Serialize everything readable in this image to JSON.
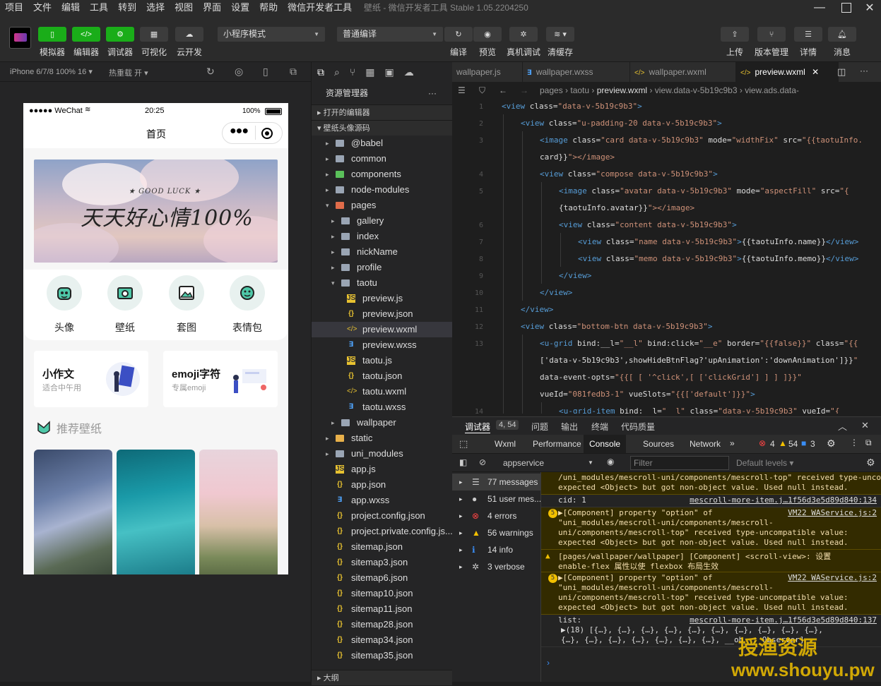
{
  "menu": [
    "项目",
    "文件",
    "编辑",
    "工具",
    "转到",
    "选择",
    "视图",
    "界面",
    "设置",
    "帮助",
    "微信开发者工具"
  ],
  "window_title": "壁纸 - 微信开发者工具 Stable 1.05.2204250",
  "toolbar": {
    "simulator": "模拟器",
    "editor": "编辑器",
    "debugger": "调试器",
    "visual": "可视化",
    "cloud": "云开发",
    "mode": "小程序模式",
    "compile": "普通编译",
    "compile_btn": "编译",
    "preview": "预览",
    "remote_debug": "真机调试",
    "clear_cache": "清缓存",
    "upload": "上传",
    "version": "版本管理",
    "detail": "详情",
    "message": "消息"
  },
  "subbar": {
    "device": "iPhone 6/7/8 100% 16",
    "hot_reload": "热重载 开"
  },
  "phone": {
    "carrier": "●●●●● WeChat",
    "time": "20:25",
    "battery": "100%",
    "page_title": "首页",
    "banner_small": "★ GOOD LUCK ★",
    "banner_big": "天天好心情100%",
    "icons": [
      {
        "label": "头像",
        "icon": "avatar-icon"
      },
      {
        "label": "壁纸",
        "icon": "wallpaper-icon"
      },
      {
        "label": "套图",
        "icon": "gallery-icon"
      },
      {
        "label": "表情包",
        "icon": "emoji-icon"
      }
    ],
    "promo": [
      {
        "title": "小作文",
        "sub": "适合中午用"
      },
      {
        "title": "emoji字符",
        "sub": "专属emoji"
      }
    ],
    "recommend": "推荐壁纸"
  },
  "explorer": {
    "title": "资源管理器",
    "sec_open": "打开的编辑器",
    "sec_project": "壁纸头像源码",
    "sec_outline": "大纲",
    "tree": [
      {
        "name": "@babel",
        "t": "folder",
        "d": 0,
        "open": false
      },
      {
        "name": "common",
        "t": "folder",
        "d": 0,
        "open": false
      },
      {
        "name": "components",
        "t": "folder",
        "d": 0,
        "open": false
      },
      {
        "name": "node-modules",
        "t": "folder",
        "d": 0,
        "open": false
      },
      {
        "name": "pages",
        "t": "folder",
        "d": 0,
        "open": true
      },
      {
        "name": "gallery",
        "t": "folder",
        "d": 1,
        "open": false
      },
      {
        "name": "index",
        "t": "folder",
        "d": 1,
        "open": false
      },
      {
        "name": "nickName",
        "t": "folder",
        "d": 1,
        "open": false
      },
      {
        "name": "profile",
        "t": "folder",
        "d": 1,
        "open": false
      },
      {
        "name": "taotu",
        "t": "folder",
        "d": 1,
        "open": true
      },
      {
        "name": "preview.js",
        "t": "js",
        "d": 2
      },
      {
        "name": "preview.json",
        "t": "json",
        "d": 2
      },
      {
        "name": "preview.wxml",
        "t": "wxml",
        "d": 2,
        "sel": true
      },
      {
        "name": "preview.wxss",
        "t": "wxss",
        "d": 2
      },
      {
        "name": "taotu.js",
        "t": "js",
        "d": 2
      },
      {
        "name": "taotu.json",
        "t": "json",
        "d": 2
      },
      {
        "name": "taotu.wxml",
        "t": "wxml",
        "d": 2
      },
      {
        "name": "taotu.wxss",
        "t": "wxss",
        "d": 2
      },
      {
        "name": "wallpaper",
        "t": "folder",
        "d": 1,
        "open": false
      },
      {
        "name": "static",
        "t": "folder",
        "d": 0,
        "open": false
      },
      {
        "name": "uni_modules",
        "t": "folder",
        "d": 0,
        "open": false
      },
      {
        "name": "app.js",
        "t": "js",
        "d": 0
      },
      {
        "name": "app.json",
        "t": "json",
        "d": 0
      },
      {
        "name": "app.wxss",
        "t": "wxss",
        "d": 0
      },
      {
        "name": "project.config.json",
        "t": "json",
        "d": 0
      },
      {
        "name": "project.private.config.js...",
        "t": "json",
        "d": 0
      },
      {
        "name": "sitemap.json",
        "t": "json",
        "d": 0
      },
      {
        "name": "sitemap3.json",
        "t": "json",
        "d": 0
      },
      {
        "name": "sitemap6.json",
        "t": "json",
        "d": 0
      },
      {
        "name": "sitemap10.json",
        "t": "json",
        "d": 0
      },
      {
        "name": "sitemap11.json",
        "t": "json",
        "d": 0
      },
      {
        "name": "sitemap28.json",
        "t": "json",
        "d": 0
      },
      {
        "name": "sitemap34.json",
        "t": "json",
        "d": 0
      },
      {
        "name": "sitemap35.json",
        "t": "json",
        "d": 0
      }
    ]
  },
  "tabs": [
    {
      "name": "wallpaper.js",
      "t": "js"
    },
    {
      "name": "wallpaper.wxss",
      "t": "wxss"
    },
    {
      "name": "wallpaper.wxml",
      "t": "wxml"
    },
    {
      "name": "preview.wxml",
      "t": "wxml",
      "active": true
    }
  ],
  "breadcrumb": [
    "pages",
    "taotu",
    "preview.wxml",
    "view.data-v-5b19c9b3",
    "view.ads.data-"
  ],
  "code": [
    {
      "n": "1",
      "i": 0,
      "h": "<view class=\"data-v-5b19c9b3\">"
    },
    {
      "n": "2",
      "i": 1,
      "h": "<view class=\"u-padding-20 data-v-5b19c9b3\">"
    },
    {
      "n": "3",
      "i": 2,
      "h": "<image class=\"card data-v-5b19c9b3\" mode=\"widthFix\" src=\"{{taotuInfo."
    },
    {
      "n": "",
      "i": 2,
      "h": "card}}\"></image>"
    },
    {
      "n": "4",
      "i": 2,
      "h": "<view class=\"compose data-v-5b19c9b3\">"
    },
    {
      "n": "5",
      "i": 3,
      "h": "<image class=\"avatar data-v-5b19c9b3\" mode=\"aspectFill\" src=\"{"
    },
    {
      "n": "",
      "i": 3,
      "h": "{taotuInfo.avatar}}\"></image>"
    },
    {
      "n": "6",
      "i": 3,
      "h": "<view class=\"content data-v-5b19c9b3\">"
    },
    {
      "n": "7",
      "i": 4,
      "h": "<view class=\"name data-v-5b19c9b3\">{{taotuInfo.name}}</view>"
    },
    {
      "n": "8",
      "i": 4,
      "h": "<view class=\"memo data-v-5b19c9b3\">{{taotuInfo.memo}}</view>"
    },
    {
      "n": "9",
      "i": 3,
      "h": "</view>"
    },
    {
      "n": "10",
      "i": 2,
      "h": "</view>"
    },
    {
      "n": "11",
      "i": 1,
      "h": "</view>"
    },
    {
      "n": "12",
      "i": 1,
      "h": "<view class=\"bottom-btn data-v-5b19c9b3\">"
    },
    {
      "n": "13",
      "i": 2,
      "h": "<u-grid bind:__l=\"__l\" bind:click=\"__e\" border=\"{{false}}\" class=\"{{"
    },
    {
      "n": "",
      "i": 2,
      "h": "['data-v-5b19c9b3',showHideBtnFlag?'upAnimation':'downAnimation']}}\""
    },
    {
      "n": "",
      "i": 2,
      "h": "data-event-opts=\"{{[ [ '^click',[ ['clickGrid'] ] ] ]}}\""
    },
    {
      "n": "",
      "i": 2,
      "h": "vueId=\"081fedb3-1\" vueSlots=\"{{['default']}}\">"
    },
    {
      "n": "14",
      "i": 3,
      "h": "<u-grid-item bind:__l=\"__l\" class=\"data-v-5b19c9b3\" vueId=\"{"
    }
  ],
  "devtools": {
    "title": "调试器",
    "badge": "4, 54",
    "issues": "问题",
    "output": "输出",
    "terminal": "终端",
    "quality": "代码质量",
    "tabs": [
      "Wxml",
      "Performance",
      "Console",
      "Sources",
      "Network"
    ],
    "active_tab": "Console",
    "errors": "4",
    "warnings": "54",
    "infos": "3",
    "context": "appservice",
    "filter": "Filter",
    "levels": "Default levels",
    "side": [
      {
        "label": "77 messages",
        "icon": "list-icon"
      },
      {
        "label": "51 user mes...",
        "icon": "user-icon"
      },
      {
        "label": "4 errors",
        "icon": "error-icon"
      },
      {
        "label": "56 warnings",
        "icon": "warning-icon"
      },
      {
        "label": "14 info",
        "icon": "info-icon"
      },
      {
        "label": "3 verbose",
        "icon": "verbose-icon"
      }
    ],
    "logs": [
      {
        "k": "warn",
        "lines": [
          "/uni_modules/mescroll-uni/components/mescroll-top\" received type-uncompatible value:",
          "expected <Object> but got non-object value. Used null instead."
        ]
      },
      {
        "k": "plain",
        "left": "cid: 1",
        "link": "mescroll-more-item.j…1f56d3e5d89d840:134"
      },
      {
        "k": "warn",
        "badge": "5",
        "link": "VM22 WAService.js:2",
        "lines": [
          "▶[Component] property \"option\" of",
          "\"uni_modules/mescroll-uni/components/mescroll-",
          "uni/components/mescroll-top\" received type-uncompatible value:",
          "expected <Object> but got non-object value. Used null instead."
        ]
      },
      {
        "k": "warn",
        "tri": true,
        "lines": [
          "[pages/wallpaper/wallpaper] [Component] <scroll-view>: 设置",
          "enable-flex 属性以使 flexbox 布局生效"
        ]
      },
      {
        "k": "warn",
        "badge": "5",
        "link": "VM22 WAService.js:2",
        "lines": [
          "▶[Component] property \"option\" of",
          "\"uni_modules/mescroll-uni/components/mescroll-",
          "uni/components/mescroll-top\" received type-uncompatible value:",
          "expected <Object> but got non-object value. Used null instead."
        ]
      },
      {
        "k": "plain",
        "left": "list:",
        "link": "mescroll-more-item.j…1f56d3e5d89d840:137",
        "lines": [
          "▶(18) [{…}, {…}, {…}, {…}, {…}, {…}, {…}, {…}, {…}, {…},",
          "{…}, {…}, {…}, {…}, {…}, {…}, {…}, __ob__: Observer]"
        ]
      }
    ]
  },
  "watermark": {
    "line1": "授渔资源",
    "line2": "www.shouyu.pw"
  }
}
